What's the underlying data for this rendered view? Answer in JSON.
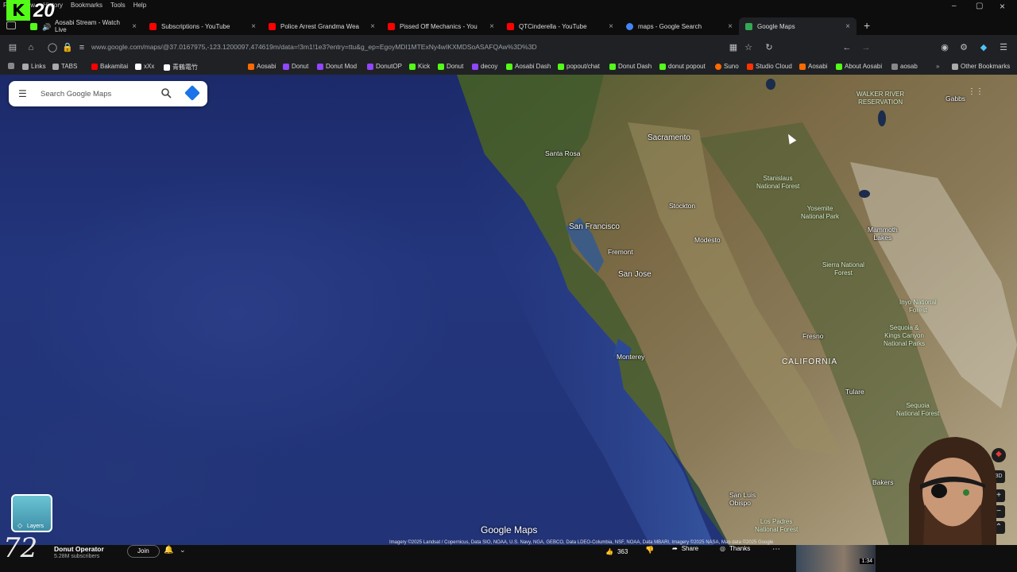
{
  "overlay": {
    "top_left_badge": "20",
    "bottom_left_badge": "72"
  },
  "menu": [
    "File",
    "View",
    "History",
    "Bookmarks",
    "Tools",
    "Help"
  ],
  "tabs": [
    {
      "label": "Aosabi Stream - Watch Live",
      "favicon_color": "#53fc18"
    },
    {
      "label": "Subscriptions - YouTube",
      "favicon_color": "#ff0000"
    },
    {
      "label": "Police Arrest Grandma Wea",
      "favicon_color": "#ff0000"
    },
    {
      "label": "Pissed Off Mechanics - You",
      "favicon_color": "#ff0000"
    },
    {
      "label": "QTCinderella - YouTube",
      "favicon_color": "#ff0000"
    },
    {
      "label": "maps - Google Search",
      "favicon_color": "#4285f4"
    },
    {
      "label": "Google Maps",
      "favicon_color": "#34a853"
    }
  ],
  "url": "www.google.com/maps/@37.0167975,-123.1200097,474619m/data=!3m1!1e3?entry=ttu&g_ep=EgoyMDI1MTExNy4wIKXMDSoASAFQAw%3D%3D",
  "bookmarks": [
    {
      "label": "Links",
      "color": "#aaaaaa"
    },
    {
      "label": "TABS",
      "color": "#aaaaaa"
    },
    {
      "label": "Bakamitai",
      "color": "#ff0000"
    },
    {
      "label": "xXx",
      "color": "#ffffff"
    },
    {
      "label": "青鶴電竹",
      "color": "#ffffff"
    },
    {
      "label": "Aosabi",
      "color": "#ff6a00"
    },
    {
      "label": "Donut",
      "color": "#9146ff"
    },
    {
      "label": "Donut Mod",
      "color": "#9146ff"
    },
    {
      "label": "DonutOP",
      "color": "#9146ff"
    },
    {
      "label": "Kick",
      "color": "#53fc18"
    },
    {
      "label": "Donut",
      "color": "#53fc18"
    },
    {
      "label": "decoy",
      "color": "#9146ff"
    },
    {
      "label": "Aosabi Dash",
      "color": "#53fc18"
    },
    {
      "label": "popout/chat",
      "color": "#53fc18"
    },
    {
      "label": "Donut Dash",
      "color": "#53fc18"
    },
    {
      "label": "donut popout",
      "color": "#53fc18"
    },
    {
      "label": "Suno",
      "color": "#ff6a00"
    },
    {
      "label": "Studio Cloud",
      "color": "#ff3300"
    },
    {
      "label": "Aosabi",
      "color": "#ff6a00"
    },
    {
      "label": "About Aosabi",
      "color": "#53fc18"
    },
    {
      "label": "aosab",
      "color": "#aaaaaa"
    }
  ],
  "other_bookmarks": "Other Bookmarks",
  "search": {
    "placeholder": "Search Google Maps"
  },
  "map_labels": {
    "walker_river": "WALKER RIVER\nRESERVATION",
    "gabbs": "Gabbs",
    "sacramento": "Sacramento",
    "santa_rosa": "Santa Rosa",
    "stanislaus": "Stanislaus\nNational Forest",
    "stockton": "Stockton",
    "yosemite": "Yosemite\nNational Park",
    "mammoth": "Mammoth\nLakes",
    "san_francisco": "San Francisco",
    "modesto": "Modesto",
    "fremont": "Fremont",
    "sierra": "Sierra National\nForest",
    "san_jose": "San Jose",
    "inyo": "Inyo National\nForest",
    "sequoia_kings": "Sequoia &\nKings Canyon\nNational Parks",
    "fresno": "Fresno",
    "monterey": "Monterey",
    "california": "CALIFORNIA",
    "tulare": "Tulare",
    "sequoia_nf": "Sequoia\nNational Forest",
    "bakersfield": "Bakers",
    "san_luis": "San Luis\nObispo",
    "los_padres": "Los Padres\nNational Forest"
  },
  "map_logo": "Google Maps",
  "attribution": "Imagery ©2025 Landsat / Copernicus, Data SIO, NOAA, U.S. Navy, NGA, GEBCO, Data LDEO-Columbia, NSF, NOAA, Data MBARI, Imagery ©2025 NASA, Map data ©2025 Google",
  "layers_label": "Layers",
  "map_controls": {
    "tilt": "3D"
  },
  "youtube": {
    "channel": "Donut Operator",
    "subscribers": "5.28M subscribers",
    "join": "Join",
    "likes": "363",
    "share": "Share",
    "thanks": "Thanks",
    "video_time": "1:34"
  }
}
